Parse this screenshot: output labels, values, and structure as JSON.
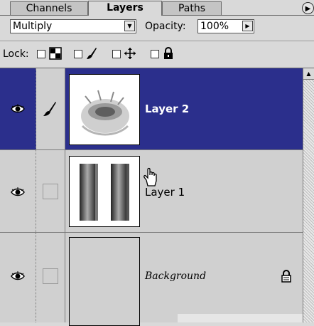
{
  "tabs": [
    {
      "label": "Channels"
    },
    {
      "label": "Layers"
    },
    {
      "label": "Paths"
    }
  ],
  "active_tab": "Layers",
  "blend": {
    "value": "Multiply"
  },
  "opacity": {
    "label": "Opacity:",
    "value": "100%"
  },
  "lock": {
    "label": "Lock:",
    "options": [
      {
        "icon": "transparency-lock-icon"
      },
      {
        "icon": "brush-lock-icon"
      },
      {
        "icon": "move-lock-icon"
      },
      {
        "icon": "padlock-icon"
      }
    ]
  },
  "layers": [
    {
      "name": "Layer 2",
      "selected": true,
      "visible": true,
      "linked_icon": "brush-icon"
    },
    {
      "name": "Layer 1",
      "selected": false,
      "visible": true
    },
    {
      "name": "Background",
      "selected": false,
      "visible": true,
      "locked": true
    }
  ],
  "colors": {
    "selection": "#2b2f8c",
    "panel": "#d9d9d9"
  }
}
